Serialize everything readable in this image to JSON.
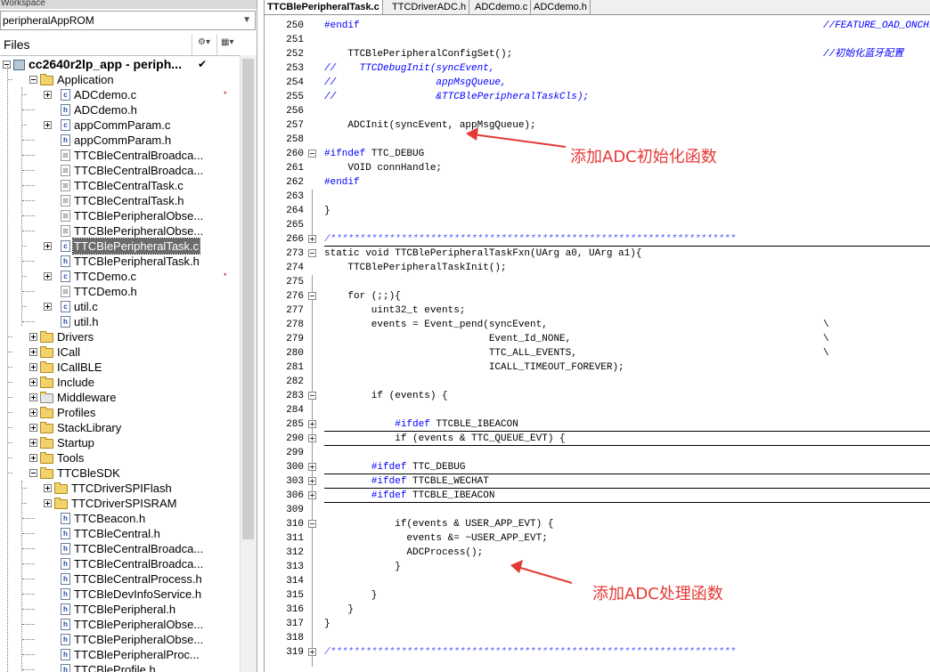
{
  "workspace": {
    "title": "Workspace",
    "configuration": "peripheralAppROM",
    "files_label": "Files",
    "project": "cc2640r2lp_app - periph...",
    "project_check": "✔",
    "tree": [
      {
        "label": "Application",
        "type": "folder",
        "level": 1,
        "expand": "minus"
      },
      {
        "label": "ADCdemo.c",
        "type": "c",
        "level": 2,
        "expand": "plus",
        "mark": "*"
      },
      {
        "label": "ADCdemo.h",
        "type": "h",
        "level": 2
      },
      {
        "label": "appCommParam.c",
        "type": "c",
        "level": 2,
        "expand": "plus"
      },
      {
        "label": "appCommParam.h",
        "type": "h",
        "level": 2
      },
      {
        "label": "TTCBleCentralBroadca...",
        "type": "x",
        "level": 2
      },
      {
        "label": "TTCBleCentralBroadca...",
        "type": "x",
        "level": 2
      },
      {
        "label": "TTCBleCentralTask.c",
        "type": "x",
        "level": 2
      },
      {
        "label": "TTCBleCentralTask.h",
        "type": "x",
        "level": 2
      },
      {
        "label": "TTCBlePeripheralObse...",
        "type": "x",
        "level": 2
      },
      {
        "label": "TTCBlePeripheralObse...",
        "type": "x",
        "level": 2
      },
      {
        "label": "TTCBlePeripheralTask.c",
        "type": "c",
        "level": 2,
        "expand": "plus",
        "selected": true
      },
      {
        "label": "TTCBlePeripheralTask.h",
        "type": "h",
        "level": 2
      },
      {
        "label": "TTCDemo.c",
        "type": "c",
        "level": 2,
        "expand": "plus",
        "mark": "*"
      },
      {
        "label": "TTCDemo.h",
        "type": "x",
        "level": 2
      },
      {
        "label": "util.c",
        "type": "c",
        "level": 2,
        "expand": "plus"
      },
      {
        "label": "util.h",
        "type": "h",
        "level": 2
      },
      {
        "label": "Drivers",
        "type": "folder",
        "level": 1,
        "expand": "plus"
      },
      {
        "label": "ICall",
        "type": "folder",
        "level": 1,
        "expand": "plus"
      },
      {
        "label": "ICallBLE",
        "type": "folder",
        "level": 1,
        "expand": "plus"
      },
      {
        "label": "Include",
        "type": "folder",
        "level": 1,
        "expand": "plus"
      },
      {
        "label": "Middleware",
        "type": "xfolder",
        "level": 1,
        "expand": "plus"
      },
      {
        "label": "Profiles",
        "type": "folder",
        "level": 1,
        "expand": "plus"
      },
      {
        "label": "StackLibrary",
        "type": "folder",
        "level": 1,
        "expand": "plus"
      },
      {
        "label": "Startup",
        "type": "folder",
        "level": 1,
        "expand": "plus"
      },
      {
        "label": "Tools",
        "type": "folder",
        "level": 1,
        "expand": "plus"
      },
      {
        "label": "TTCBleSDK",
        "type": "folder",
        "level": 1,
        "expand": "minus"
      },
      {
        "label": "TTCDriverSPIFlash",
        "type": "folder",
        "level": 2,
        "expand": "plus"
      },
      {
        "label": "TTCDriverSPISRAM",
        "type": "folder",
        "level": 2,
        "expand": "plus"
      },
      {
        "label": "TTCBeacon.h",
        "type": "h",
        "level": 2
      },
      {
        "label": "TTCBleCentral.h",
        "type": "h",
        "level": 2
      },
      {
        "label": "TTCBleCentralBroadca...",
        "type": "h",
        "level": 2
      },
      {
        "label": "TTCBleCentralBroadca...",
        "type": "h",
        "level": 2
      },
      {
        "label": "TTCBleCentralProcess.h",
        "type": "h",
        "level": 2
      },
      {
        "label": "TTCBleDevInfoService.h",
        "type": "h",
        "level": 2
      },
      {
        "label": "TTCBlePeripheral.h",
        "type": "h",
        "level": 2
      },
      {
        "label": "TTCBlePeripheralObse...",
        "type": "h",
        "level": 2
      },
      {
        "label": "TTCBlePeripheralObse...",
        "type": "h",
        "level": 2
      },
      {
        "label": "TTCBlePeripheralProc...",
        "type": "h",
        "level": 2
      },
      {
        "label": "TTCBleProfile.h",
        "type": "h",
        "level": 2
      }
    ]
  },
  "tabs": [
    {
      "label": "TTCBlePeripheralTask.c",
      "active": true
    },
    {
      "label": "TTCDriverADC.h"
    },
    {
      "label": "ADCdemo.c"
    },
    {
      "label": "ADCdemo.h"
    }
  ],
  "code_lines": [
    {
      "n": "250",
      "parts": [
        [
          "#endif",
          "kw"
        ]
      ],
      "comment": "//FEATURE_OAD_ONCHIP"
    },
    {
      "n": "251",
      "parts": []
    },
    {
      "n": "252",
      "parts": [
        [
          "    TTCBlePeripheralConfigSet();",
          ""
        ]
      ],
      "comment": "//初始化蓝牙配置"
    },
    {
      "n": "253",
      "parts": [
        [
          "//    TTCDebugInit(syncEvent,",
          "cm"
        ]
      ]
    },
    {
      "n": "254",
      "parts": [
        [
          "//                 appMsgQueue,",
          "cm"
        ]
      ]
    },
    {
      "n": "255",
      "parts": [
        [
          "//                 &TTCBlePeripheralTaskCls);",
          "cm"
        ]
      ]
    },
    {
      "n": "256",
      "parts": []
    },
    {
      "n": "257",
      "parts": [
        [
          "    ADCInit(syncEvent, appMsgQueue);",
          ""
        ]
      ]
    },
    {
      "n": "258",
      "parts": []
    },
    {
      "n": "260",
      "parts": [
        [
          "#ifndef",
          "kw"
        ],
        [
          " TTC_DEBUG",
          ""
        ]
      ],
      "fold": "minus"
    },
    {
      "n": "261",
      "parts": [
        [
          "    VOID connHandle;",
          ""
        ]
      ]
    },
    {
      "n": "262",
      "parts": [
        [
          "#endif",
          "kw"
        ]
      ]
    },
    {
      "n": "263",
      "parts": []
    },
    {
      "n": "264",
      "parts": [
        [
          "}",
          ""
        ]
      ]
    },
    {
      "n": "265",
      "parts": []
    },
    {
      "n": "266",
      "parts": [
        [
          "/*********************************************************************",
          "cm2"
        ]
      ],
      "fold": "plus",
      "underline": true
    },
    {
      "n": "273",
      "parts": [
        [
          "static void TTCBlePeripheralTaskFxn(UArg a0, UArg a1){",
          ""
        ]
      ],
      "fold": "minus"
    },
    {
      "n": "274",
      "parts": [
        [
          "    TTCBlePeripheralTaskInit();",
          ""
        ]
      ]
    },
    {
      "n": "275",
      "parts": []
    },
    {
      "n": "276",
      "parts": [
        [
          "    for (;;){",
          ""
        ]
      ],
      "fold": "minus"
    },
    {
      "n": "277",
      "parts": [
        [
          "        uint32_t events;",
          ""
        ]
      ]
    },
    {
      "n": "278",
      "parts": [
        [
          "        events = Event_pend(syncEvent,",
          ""
        ]
      ],
      "tail": "\\"
    },
    {
      "n": "279",
      "parts": [
        [
          "                            Event_Id_NONE,",
          ""
        ]
      ],
      "tail": "\\"
    },
    {
      "n": "280",
      "parts": [
        [
          "                            TTC_ALL_EVENTS,",
          ""
        ]
      ],
      "tail": "\\"
    },
    {
      "n": "281",
      "parts": [
        [
          "                            ICALL_TIMEOUT_FOREVER);",
          ""
        ]
      ]
    },
    {
      "n": "282",
      "parts": []
    },
    {
      "n": "283",
      "parts": [
        [
          "        if (events) {",
          ""
        ]
      ],
      "fold": "minus"
    },
    {
      "n": "284",
      "parts": []
    },
    {
      "n": "285",
      "parts": [
        [
          "            ",
          ""
        ],
        [
          "#ifdef",
          "kw"
        ],
        [
          " TTCBLE_IBEACON",
          ""
        ]
      ],
      "fold": "plus",
      "underline": true
    },
    {
      "n": "290",
      "parts": [
        [
          "            if (events & TTC_QUEUE_EVT) {",
          ""
        ]
      ],
      "fold": "plus",
      "underline": true
    },
    {
      "n": "299",
      "parts": []
    },
    {
      "n": "300",
      "parts": [
        [
          "        ",
          ""
        ],
        [
          "#ifdef",
          "kw"
        ],
        [
          " TTC_DEBUG",
          ""
        ]
      ],
      "fold": "plus",
      "underline": true
    },
    {
      "n": "303",
      "parts": [
        [
          "        ",
          ""
        ],
        [
          "#ifdef",
          "kw"
        ],
        [
          " TTCBLE_WECHAT",
          ""
        ]
      ],
      "fold": "plus",
      "underline": true
    },
    {
      "n": "306",
      "parts": [
        [
          "        ",
          ""
        ],
        [
          "#ifdef",
          "kw"
        ],
        [
          " TTCBLE_IBEACON",
          ""
        ]
      ],
      "fold": "plus",
      "underline": true
    },
    {
      "n": "309",
      "parts": []
    },
    {
      "n": "310",
      "parts": [
        [
          "            if(events & USER_APP_EVT) {",
          ""
        ]
      ],
      "fold": "minus"
    },
    {
      "n": "311",
      "parts": [
        [
          "              events &= ~USER_APP_EVT;",
          ""
        ]
      ]
    },
    {
      "n": "312",
      "parts": [
        [
          "              ADCProcess();",
          ""
        ]
      ]
    },
    {
      "n": "313",
      "parts": [
        [
          "            }",
          ""
        ]
      ]
    },
    {
      "n": "314",
      "parts": []
    },
    {
      "n": "315",
      "parts": [
        [
          "        }",
          ""
        ]
      ]
    },
    {
      "n": "316",
      "parts": [
        [
          "    }",
          ""
        ]
      ]
    },
    {
      "n": "317",
      "parts": [
        [
          "}",
          ""
        ]
      ]
    },
    {
      "n": "318",
      "parts": []
    },
    {
      "n": "319",
      "parts": [
        [
          "/*********************************************************************",
          "cm2"
        ]
      ],
      "fold": "plus"
    }
  ],
  "annotations": {
    "adc_init": "添加ADC初始化函数",
    "adc_process": "添加ADC处理函数"
  },
  "colors": {
    "annotation": "#e53935",
    "keyword": "#0000ff",
    "selection": "#6b6b6b"
  }
}
